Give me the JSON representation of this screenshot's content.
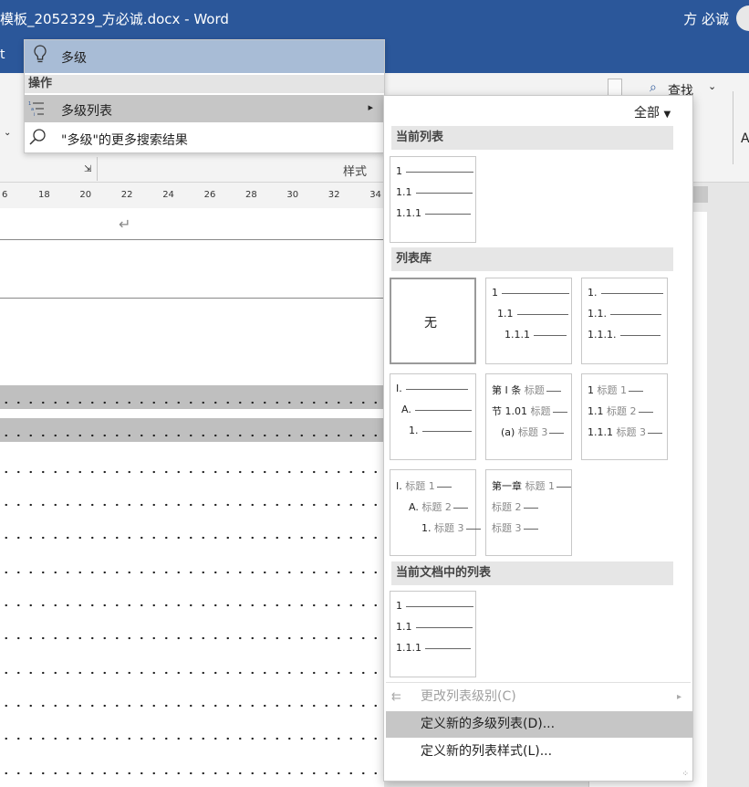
{
  "window": {
    "title": "模板_2052329_方必诚.docx - Word",
    "user": "方 必诚"
  },
  "ribbon": {
    "find": "查找",
    "styles_label": "样式"
  },
  "ruler": [
    "6",
    "18",
    "20",
    "22",
    "24",
    "26",
    "28",
    "30",
    "32",
    "34"
  ],
  "search": {
    "query": "多级",
    "section": "操作",
    "action": "多级列表",
    "more": "\"多级\"的更多搜索结果"
  },
  "gallery": {
    "filter": "全部",
    "sections": {
      "current": "当前列表",
      "library": "列表库",
      "document": "当前文档中的列表"
    },
    "none_label": "无",
    "thumbs": {
      "current": [
        "1",
        "1.1",
        "1.1.1"
      ],
      "lib2": [
        "1",
        "1.1",
        "1.1.1"
      ],
      "lib3": [
        "1.",
        "1.1.",
        "1.1.1."
      ],
      "lib4": [
        "I.",
        "A.",
        "1."
      ],
      "lib5": [
        {
          "num": "第 I 条",
          "lab": "标题"
        },
        {
          "num": "节 1.01",
          "lab": "标题"
        },
        {
          "num": "(a)",
          "lab": "标题 3"
        }
      ],
      "lib6": [
        {
          "num": "1",
          "lab": "标题 1"
        },
        {
          "num": "1.1",
          "lab": "标题 2"
        },
        {
          "num": "1.1.1",
          "lab": "标题 3"
        }
      ],
      "lib7": [
        {
          "num": "I.",
          "lab": "标题 1"
        },
        {
          "num": "A.",
          "lab": "标题 2"
        },
        {
          "num": "1.",
          "lab": "标题 3"
        }
      ],
      "lib8": [
        {
          "num": "第一章",
          "lab": "标题 1"
        },
        {
          "num": "",
          "lab": "标题 2"
        },
        {
          "num": "",
          "lab": "标题 3"
        }
      ],
      "doc": [
        "1",
        "1.1",
        "1.1.1"
      ]
    },
    "menu": {
      "change_level": "更改列表级别(C)",
      "define_multilevel": "定义新的多级列表(D)...",
      "define_style": "定义新的列表样式(L)..."
    }
  },
  "colors": {
    "title_bar": "#2b579a",
    "search_box": "#a8bcd6",
    "hover": "#c6c6c6"
  }
}
